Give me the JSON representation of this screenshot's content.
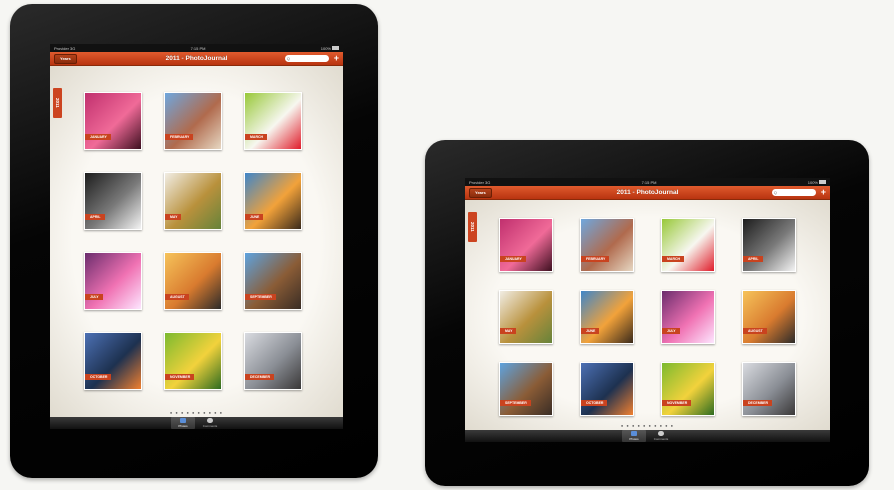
{
  "portrait": {
    "status": {
      "carrier": "Provider 3G",
      "time": "7:15 PM",
      "battery": "100%"
    },
    "nav": {
      "back_label": "Years",
      "title": "2011 - PhotoJournal",
      "search_placeholder": "Q",
      "add_label": "+"
    },
    "year_tab": "2011",
    "tiles": [
      {
        "month": "JANUARY",
        "colors": [
          "#c0306e",
          "#f06a98",
          "#3d1020"
        ]
      },
      {
        "month": "FEBRUARY",
        "colors": [
          "#6fa7de",
          "#b06a4d",
          "#e6d7c2"
        ]
      },
      {
        "month": "MARCH",
        "colors": [
          "#98c838",
          "#f7f7f0",
          "#e01c2a"
        ]
      },
      {
        "month": "APRIL",
        "colors": [
          "#1d1d1d",
          "#7a7a7a",
          "#f4f4f4"
        ]
      },
      {
        "month": "MAY",
        "colors": [
          "#f1ede4",
          "#b9913c",
          "#66833a"
        ]
      },
      {
        "month": "JUNE",
        "colors": [
          "#3f86c9",
          "#f2a23a",
          "#3a2a1b"
        ]
      },
      {
        "month": "JULY",
        "colors": [
          "#6b2d6d",
          "#f072b3",
          "#fde6ff"
        ]
      },
      {
        "month": "AUGUST",
        "colors": [
          "#f6c35a",
          "#d97b2f",
          "#2c2b2a"
        ]
      },
      {
        "month": "SEPTEMBER",
        "colors": [
          "#5ea3df",
          "#8a5c36",
          "#3a2d25"
        ]
      },
      {
        "month": "OCTOBER",
        "colors": [
          "#4c70b4",
          "#1d3150",
          "#f08030"
        ]
      },
      {
        "month": "NOVEMBER",
        "colors": [
          "#7cba2f",
          "#f2d23c",
          "#2e6c20"
        ]
      },
      {
        "month": "DECEMBER",
        "colors": [
          "#d9dbe0",
          "#8a8e95",
          "#3a3838"
        ]
      }
    ],
    "page_dots": "● ● ● ● ● ● ● ● ● ●",
    "tabs": [
      {
        "label": "Photos"
      },
      {
        "label": "Comments"
      }
    ]
  },
  "landscape": {
    "status": {
      "carrier": "Provider 3G",
      "time": "7:15 PM",
      "battery": "100%"
    },
    "nav": {
      "back_label": "Years",
      "title": "2011 - PhotoJournal",
      "search_placeholder": "Q",
      "add_label": "+"
    },
    "year_tab": "2011",
    "tiles": [
      {
        "month": "JANUARY",
        "colors": [
          "#c0306e",
          "#f06a98",
          "#3d1020"
        ]
      },
      {
        "month": "FEBRUARY",
        "colors": [
          "#6fa7de",
          "#b06a4d",
          "#e6d7c2"
        ]
      },
      {
        "month": "MARCH",
        "colors": [
          "#98c838",
          "#f7f7f0",
          "#e01c2a"
        ]
      },
      {
        "month": "APRIL",
        "colors": [
          "#1d1d1d",
          "#7a7a7a",
          "#f4f4f4"
        ]
      },
      {
        "month": "MAY",
        "colors": [
          "#f1ede4",
          "#b9913c",
          "#66833a"
        ]
      },
      {
        "month": "JUNE",
        "colors": [
          "#3f86c9",
          "#f2a23a",
          "#3a2a1b"
        ]
      },
      {
        "month": "JULY",
        "colors": [
          "#6b2d6d",
          "#f072b3",
          "#fde6ff"
        ]
      },
      {
        "month": "AUGUST",
        "colors": [
          "#f6c35a",
          "#d97b2f",
          "#2c2b2a"
        ]
      },
      {
        "month": "SEPTEMBER",
        "colors": [
          "#5ea3df",
          "#8a5c36",
          "#3a2d25"
        ]
      },
      {
        "month": "OCTOBER",
        "colors": [
          "#4c70b4",
          "#1d3150",
          "#f08030"
        ]
      },
      {
        "month": "NOVEMBER",
        "colors": [
          "#7cba2f",
          "#f2d23c",
          "#2e6c20"
        ]
      },
      {
        "month": "DECEMBER",
        "colors": [
          "#d9dbe0",
          "#8a8e95",
          "#3a3838"
        ]
      }
    ],
    "page_dots": "● ● ● ● ● ● ● ● ● ●",
    "tabs": [
      {
        "label": "Photos"
      },
      {
        "label": "Comments"
      }
    ]
  },
  "accent_color": "#cc4420"
}
